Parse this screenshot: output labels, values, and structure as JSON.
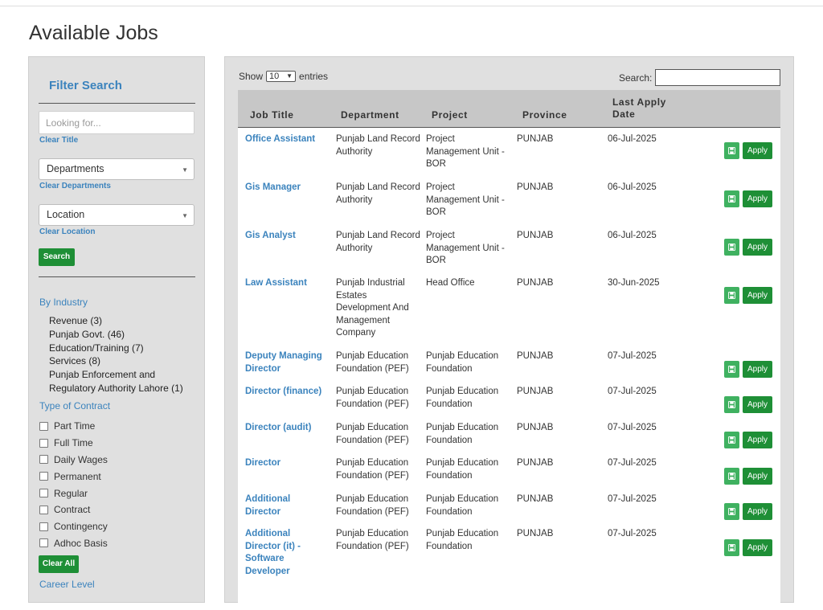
{
  "page_title": "Available Jobs",
  "sidebar": {
    "filter_title": "Filter Search",
    "looking_placeholder": "Looking for...",
    "clear_title": "Clear Title",
    "departments_value": "Departments",
    "clear_departments": "Clear Departments",
    "location_value": "Location",
    "clear_location": "Clear Location",
    "search_button": "Search",
    "by_industry": "By Industry",
    "industries": [
      "Revenue (3)",
      "Punjab Govt. (46)",
      "Education/Training (7)",
      "Services (8)",
      "Punjab Enforcement and Regulatory Authority Lahore (1)"
    ],
    "type_of_contract": "Type of Contract",
    "contracts": [
      "Part Time",
      "Full Time",
      "Daily Wages",
      "Permanent",
      "Regular",
      "Contract",
      "Contingency",
      "Adhoc Basis"
    ],
    "clear_all": "Clear All",
    "career_level": "Career Level"
  },
  "table": {
    "show_label": "Show",
    "entries_value": "10",
    "entries_label": "entries",
    "search_label": "Search:",
    "headers": {
      "title": "Job Title",
      "department": "Department",
      "project": "Project",
      "province": "Province",
      "last_apply": "Last Apply Date"
    },
    "apply_label": "Apply",
    "rows": [
      {
        "title": "Office Assistant",
        "department": "Punjab Land Record Authority",
        "project": "Project Management Unit - BOR",
        "province": "PUNJAB",
        "date": "06-Jul-2025"
      },
      {
        "title": "Gis Manager",
        "department": "Punjab Land Record Authority",
        "project": "Project Management Unit - BOR",
        "province": "PUNJAB",
        "date": "06-Jul-2025"
      },
      {
        "title": "Gis Analyst",
        "department": "Punjab Land Record Authority",
        "project": "Project Management Unit - BOR",
        "province": "PUNJAB",
        "date": "06-Jul-2025"
      },
      {
        "title": "Law Assistant",
        "department": "Punjab Industrial Estates Development And Management Company",
        "project": "Head Office",
        "province": "PUNJAB",
        "date": "30-Jun-2025"
      },
      {
        "title": "Deputy Managing Director",
        "department": "Punjab Education Foundation (PEF)",
        "project": "Punjab Education Foundation",
        "province": "PUNJAB",
        "date": "07-Jul-2025"
      },
      {
        "title": "Director (finance)",
        "department": "Punjab Education Foundation (PEF)",
        "project": "Punjab Education Foundation",
        "province": "PUNJAB",
        "date": "07-Jul-2025"
      },
      {
        "title": "Director (audit)",
        "department": "Punjab Education Foundation (PEF)",
        "project": "Punjab Education Foundation",
        "province": "PUNJAB",
        "date": "07-Jul-2025"
      },
      {
        "title": "Director",
        "department": "Punjab Education Foundation (PEF)",
        "project": "Punjab Education Foundation",
        "province": "PUNJAB",
        "date": "07-Jul-2025"
      },
      {
        "title": "Additional Director",
        "department": "Punjab Education Foundation (PEF)",
        "project": "Punjab Education Foundation",
        "province": "PUNJAB",
        "date": "07-Jul-2025"
      },
      {
        "title": "Additional Director (it) - Software Developer",
        "department": "Punjab Education Foundation (PEF)",
        "project": "Punjab Education Foundation",
        "province": "PUNJAB",
        "date": "07-Jul-2025"
      }
    ]
  },
  "colors": {
    "link": "#3b83bd",
    "button_green": "#1e8f36",
    "save_green": "#3fb160",
    "panel_gray": "#e0e0e0"
  }
}
